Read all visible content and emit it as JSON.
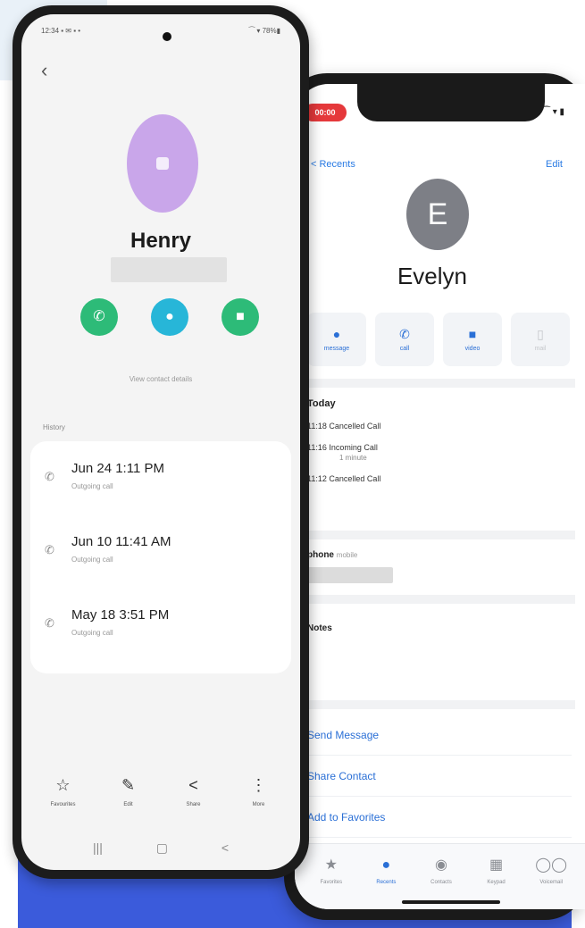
{
  "iphone": {
    "rec_label": "00:00",
    "status_right": "⁀ ▾ ▮",
    "back_label": "< Recents",
    "edit_label": "Edit",
    "avatar_initial": "E",
    "contact_name": "Evelyn",
    "actions": [
      {
        "icon": "message-icon",
        "glyph": "●",
        "label": "message"
      },
      {
        "icon": "phone-icon",
        "glyph": "✆",
        "label": "call"
      },
      {
        "icon": "video-icon",
        "glyph": "■",
        "label": "video"
      },
      {
        "icon": "mail-icon",
        "glyph": "▯",
        "label": "mail"
      }
    ],
    "history": {
      "heading": "Today",
      "rows": [
        {
          "text": "11:18 Cancelled Call"
        },
        {
          "text": "11:16 Incoming Call",
          "sub": "1 minute"
        },
        {
          "text": "11:12 Cancelled Call"
        }
      ]
    },
    "phone_field": {
      "label": "phone",
      "sub": "mobile"
    },
    "notes_label": "Notes",
    "links": [
      "Send Message",
      "Share Contact",
      "Add to Favorites"
    ],
    "tabs": [
      {
        "icon": "star-icon",
        "glyph": "★",
        "label": "Favorites"
      },
      {
        "icon": "recents-icon",
        "glyph": "●",
        "label": "Recents",
        "active": true
      },
      {
        "icon": "contacts-icon",
        "glyph": "◉",
        "label": "Contacts"
      },
      {
        "icon": "keypad-icon",
        "glyph": "▦",
        "label": "Keypad"
      },
      {
        "icon": "voicemail-icon",
        "glyph": "◯◯",
        "label": "Voicemail"
      }
    ]
  },
  "android": {
    "status_left": "12:34 ▪ ✉ ▪ •",
    "status_right": "⁀ ▾ 78%▮",
    "contact_name": "Henry",
    "view_label": "View contact details",
    "history_label": "History",
    "history": [
      {
        "date": "Jun 24 1:11 PM",
        "sub": "Outgoing call"
      },
      {
        "date": "Jun 10 11:41 AM",
        "sub": "Outgoing call"
      },
      {
        "date": "May 18 3:51 PM",
        "sub": "Outgoing call"
      }
    ],
    "bottom_actions": [
      {
        "icon": "star-outline-icon",
        "glyph": "☆",
        "label": "Favourites"
      },
      {
        "icon": "edit-icon",
        "glyph": "✎",
        "label": "Edit"
      },
      {
        "icon": "share-icon",
        "glyph": "<",
        "label": "Share"
      },
      {
        "icon": "more-icon",
        "glyph": "⋮",
        "label": "More"
      }
    ],
    "nav": [
      "|||",
      "▢",
      "<"
    ]
  },
  "colors": {
    "blue_base": "#3b5bdb",
    "android_avatar": "#c9a6ea",
    "android_green": "#2dbb78",
    "android_teal": "#27b6d8",
    "ios_accent": "#2a6fd6",
    "rec_red": "#e5383b"
  }
}
